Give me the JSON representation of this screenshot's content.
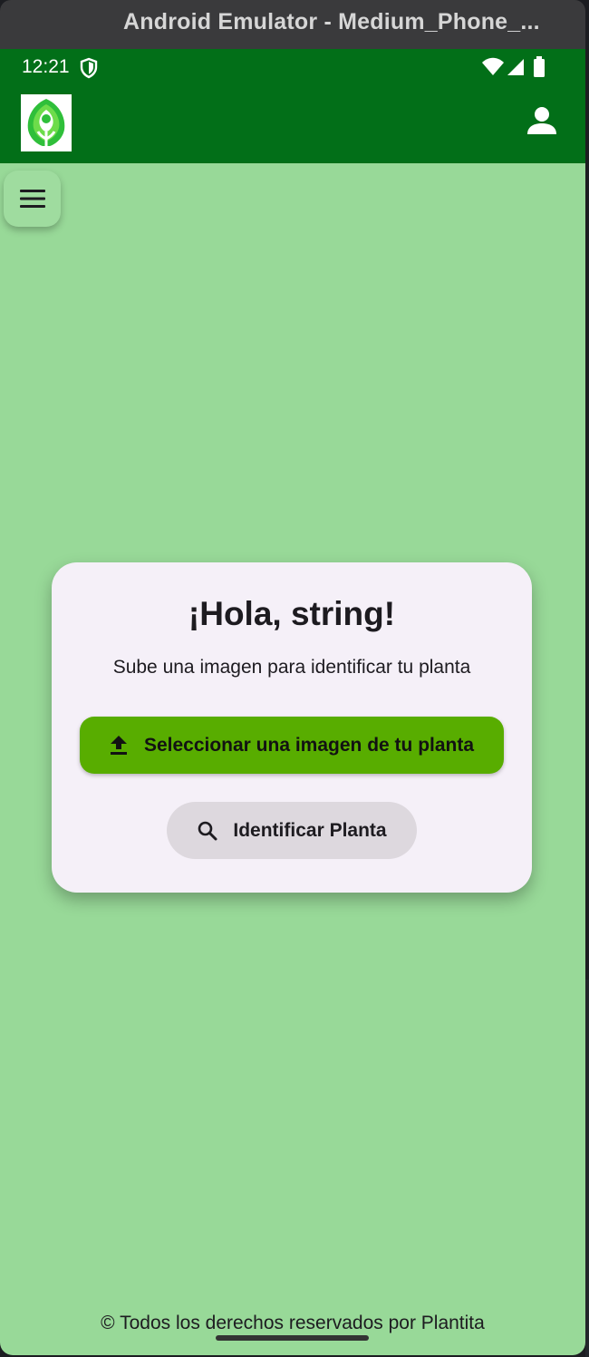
{
  "window": {
    "title": "Android Emulator - Medium_Phone_..."
  },
  "status_bar": {
    "time": "12:21",
    "icons": [
      "shield-icon",
      "wifi-icon",
      "signal-icon",
      "battery-icon"
    ]
  },
  "app_bar": {
    "logo": "plant-tree-logo",
    "profile_icon": "person-icon"
  },
  "menu_button": {
    "icon": "hamburger-menu-icon"
  },
  "card": {
    "greeting": "¡Hola, string!",
    "subtitle": "Sube una imagen para identificar tu planta",
    "select_button": {
      "label": "Seleccionar una imagen de tu planta",
      "icon": "upload-icon"
    },
    "identify_button": {
      "label": "Identificar Planta",
      "icon": "search-icon"
    }
  },
  "footer": {
    "text": "© Todos los derechos reservados por Plantita"
  },
  "colors": {
    "app_bar": "#026f18",
    "background": "#98d998",
    "card": "#f5f0f8",
    "primary_button": "#58ad00",
    "secondary_button": "#ddd8de"
  }
}
